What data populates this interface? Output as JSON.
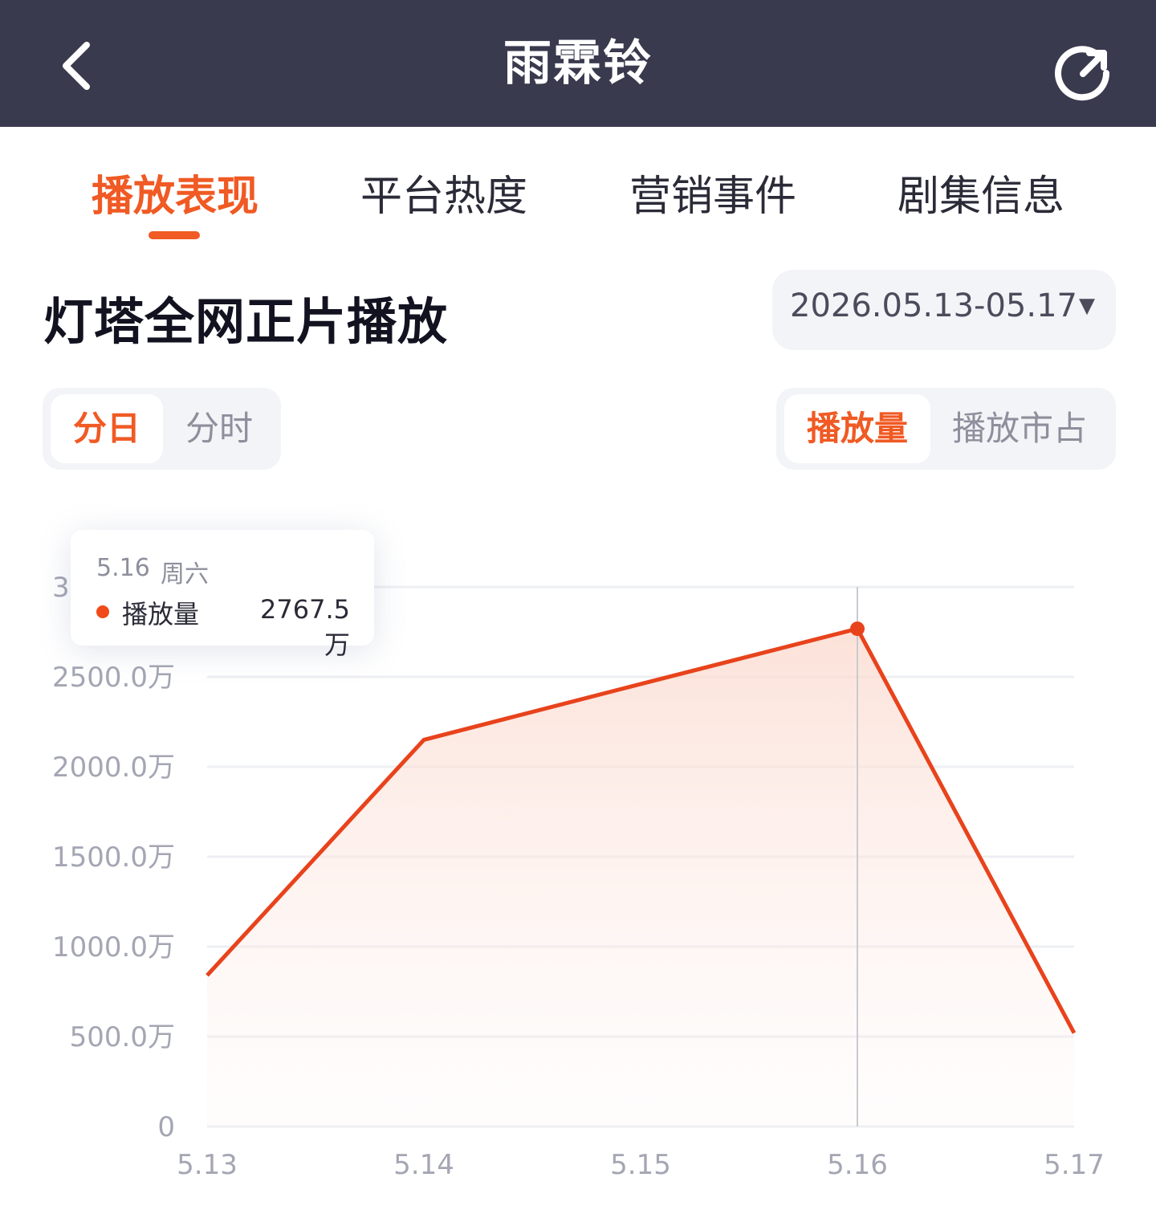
{
  "header": {
    "title": "雨霖铃",
    "back_icon": "chevron-left-icon",
    "refresh_icon": "refresh-icon"
  },
  "tabs": [
    {
      "label": "播放表现",
      "active": true
    },
    {
      "label": "平台热度",
      "active": false
    },
    {
      "label": "营销事件",
      "active": false
    },
    {
      "label": "剧集信息",
      "active": false
    }
  ],
  "section": {
    "title": "灯塔全网正片播放",
    "date_range": "2026.05.13-05.17",
    "caret": "▼"
  },
  "granularity": {
    "options": [
      "分日",
      "分时"
    ],
    "selected": "分日"
  },
  "metric": {
    "options": [
      "播放量",
      "播放市占"
    ],
    "selected": "播放量"
  },
  "tooltip": {
    "date": "5.16",
    "day": "周六",
    "label": "播放量",
    "value": "2767.5万"
  },
  "colors": {
    "accent": "#f05a24",
    "line": "#e8431c",
    "header_bg": "#393a4e"
  },
  "chart_data": {
    "type": "area",
    "categories": [
      "5.13",
      "5.14",
      "5.15",
      "5.16",
      "5.17"
    ],
    "values": [
      840,
      2150,
      2460,
      2767.5,
      520
    ],
    "unit": "万",
    "ylim": [
      0,
      3000
    ],
    "yticks": [
      {
        "value": 0,
        "label": "0"
      },
      {
        "value": 500,
        "label": "500.0万"
      },
      {
        "value": 1000,
        "label": "1000.0万"
      },
      {
        "value": 1500,
        "label": "1500.0万"
      },
      {
        "value": 2000,
        "label": "2000.0万"
      },
      {
        "value": 2500,
        "label": "2500.0万"
      },
      {
        "value": 3000,
        "label": "3000.0万"
      }
    ],
    "highlight_index": 3,
    "grid": true
  }
}
